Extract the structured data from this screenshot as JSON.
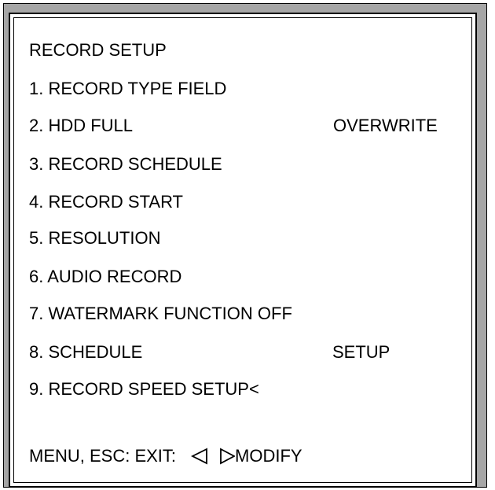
{
  "menu": {
    "title": "RECORD SETUP",
    "items": [
      {
        "label": "1. RECORD TYPE FIELD",
        "value": ""
      },
      {
        "label": "2. HDD FULL",
        "value": "OVERWRITE"
      },
      {
        "label": "3. RECORD SCHEDULE",
        "value": ""
      },
      {
        "label": "4. RECORD START",
        "value": ""
      },
      {
        "label": "5. RESOLUTION",
        "value": ""
      },
      {
        "label": "6. AUDIO RECORD",
        "value": ""
      },
      {
        "label": "7. WATERMARK FUNCTION OFF",
        "value": ""
      },
      {
        "label": "8. SCHEDULE",
        "value": "SETUP"
      },
      {
        "label": "9. RECORD SPEED SETUP<",
        "value": ""
      }
    ]
  },
  "footer": {
    "exit_text": "MENU, ESC: EXIT:",
    "modify_text": "MODIFY",
    "left_arrow_icon": "triangle-left-outline",
    "right_arrow_icon": "triangle-right-outline"
  }
}
